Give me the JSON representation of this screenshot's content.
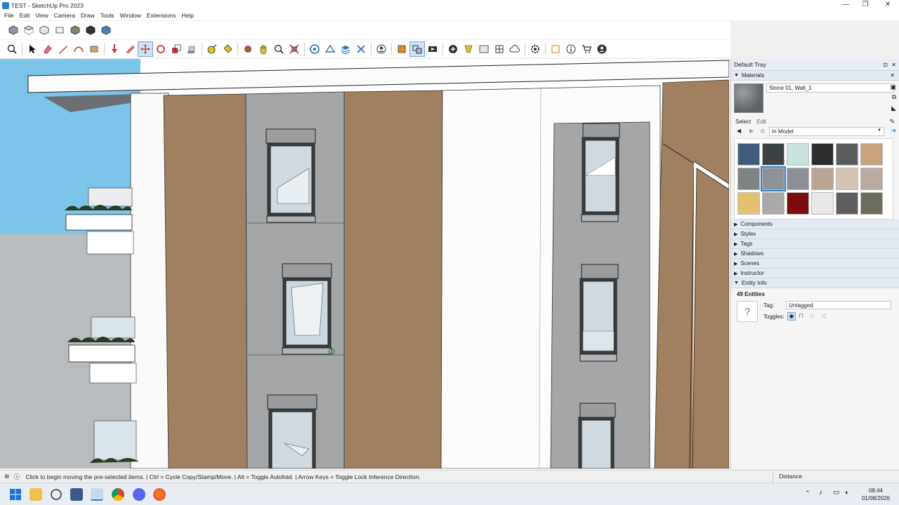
{
  "window": {
    "title": "TEST - SketchUp Pro 2023",
    "minimize": "—",
    "maximize": "❐",
    "close": "✕"
  },
  "menu": [
    "File",
    "Edit",
    "View",
    "Camera",
    "Draw",
    "Tools",
    "Window",
    "Extensions",
    "Help"
  ],
  "tray": {
    "title": "Default Tray",
    "materials": {
      "header": "Materials",
      "material_name": "Stone 01, Wall_1",
      "tab_select": "Select",
      "tab_edit": "Edit",
      "library": "In Model",
      "swatch_colors": [
        "#3f5c7a",
        "#3a4244",
        "#c8e3de",
        "#2e2e2e",
        "#5a5c5e",
        "#c9a27e",
        "#7f8384",
        "#8d9296",
        "#8c9094",
        "#b9a594",
        "#d4c4b6",
        "#b8aca2",
        "#e2c171",
        "#a9a9a9",
        "#7a0c0c",
        "#e8e8e8",
        "#5d5d5d",
        "#6c6d5c"
      ]
    },
    "panels": [
      "Components",
      "Styles",
      "Tags",
      "Shadows",
      "Scenes",
      "Instructor"
    ],
    "entity_info": {
      "header": "Entity Info",
      "count": "49 Entities",
      "tag_label": "Tag:",
      "tag_value": "Untagged",
      "toggles_label": "Toggles:"
    }
  },
  "status": {
    "message": "Click to begin moving the pre-selected items.  |  Ctrl = Cycle Copy/Stamp/Move.  |  Alt = Toggle Autofold.  |  Arrow Keys = Toggle Lock Inference Direction.",
    "measure_label": "Distance"
  },
  "taskbar": {
    "time": "08:44",
    "date": "01/08/2026"
  },
  "colors": {
    "facade_wood": "#a0805e",
    "facade_grey": "#a4a6a8",
    "sky": "#7cc4ea",
    "accent": "#2a7fc9"
  }
}
